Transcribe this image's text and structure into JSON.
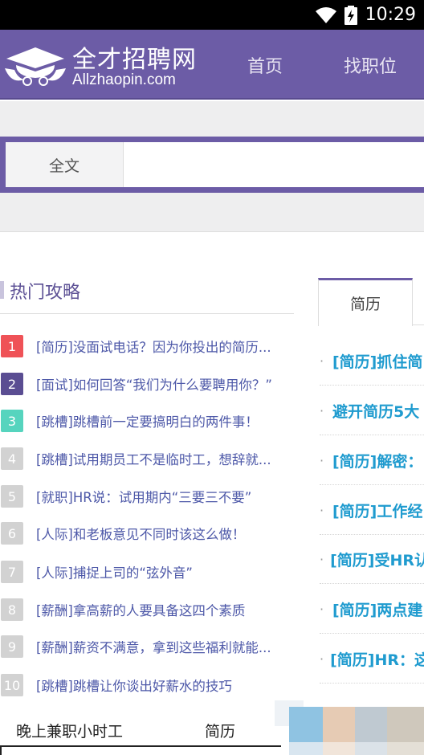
{
  "status_bar": {
    "time": "10:29"
  },
  "header": {
    "logo_cn": "全才招聘网",
    "logo_en": "Allzhaopin.com",
    "nav": [
      "首页",
      "找职位"
    ]
  },
  "search": {
    "type_label": "全文",
    "placeholder": ""
  },
  "hot": {
    "title": "热门攻略",
    "items": [
      {
        "rank": "1",
        "text": "[简历]没面试电话？因为你投出的简历..."
      },
      {
        "rank": "2",
        "text": "[面试]如何回答“我们为什么要聘用你？”"
      },
      {
        "rank": "3",
        "text": "[跳槽]跳槽前一定要搞明白的两件事！"
      },
      {
        "rank": "4",
        "text": "[跳槽]试用期员工不是临时工，想辞就..."
      },
      {
        "rank": "5",
        "text": "[就职]HR说：试用期内“三要三不要”"
      },
      {
        "rank": "6",
        "text": "[人际]和老板意见不同时该这么做！"
      },
      {
        "rank": "7",
        "text": "[人际]捕捉上司的“弦外音”"
      },
      {
        "rank": "8",
        "text": "[薪酬]拿高薪的人要具备这四个素质"
      },
      {
        "rank": "9",
        "text": "[薪酬]薪资不满意，拿到这些福利就能..."
      },
      {
        "rank": "10",
        "text": "[跳槽]跳槽让你谈出好薪水的技巧"
      }
    ]
  },
  "resume_tab": {
    "label": "简历",
    "items": [
      "[简历]抓住简",
      "避开简历5大",
      "[简历]解密：",
      "[简历]工作经",
      "[简历]受HR认",
      "[简历]两点建",
      "[简历]HR：这"
    ]
  },
  "bottom_tabs": [
    "晚上兼职小时工",
    "简历"
  ],
  "colors": {
    "brand": "#6c5ca6",
    "rank1": "#ef5257",
    "rank2": "#5a4d92",
    "rank3": "#56d4be",
    "link": "#4d58a8",
    "resume_link": "#1f9bcf"
  }
}
